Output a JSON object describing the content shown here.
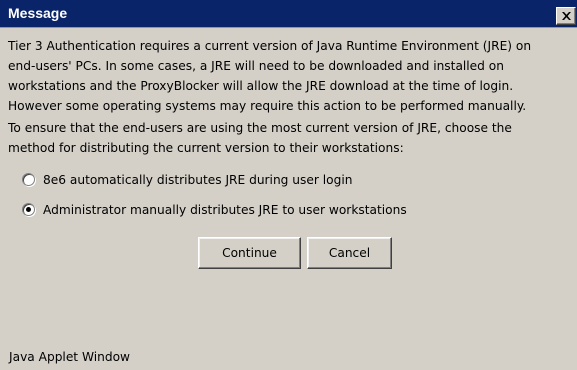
{
  "window": {
    "title": "Message",
    "footer": "Java Applet Window",
    "close_icon": "close-icon"
  },
  "message": {
    "paragraph1": [
      "Tier 3 Authentication requires a current version of Java Runtime Environment (JRE) on",
      "end-users' PCs.  In some cases, a JRE will need to be downloaded and installed on",
      "workstations and the ProxyBlocker will allow the JRE download at the time of login.",
      "However some operating systems may require this action to be performed manually."
    ],
    "paragraph2": [
      "To ensure that the end-users are using the most current version of JRE, choose the",
      "method for distributing the current version to their workstations:"
    ]
  },
  "options": [
    {
      "label": "8e6 automatically distributes JRE during user login",
      "selected": false
    },
    {
      "label": "Administrator manually distributes JRE to user workstations",
      "selected": true
    }
  ],
  "buttons": {
    "continue": "Continue",
    "cancel": "Cancel"
  },
  "colors": {
    "titlebar": "#0a246a",
    "title_text": "#ffffff",
    "background": "#d4d0c8"
  }
}
